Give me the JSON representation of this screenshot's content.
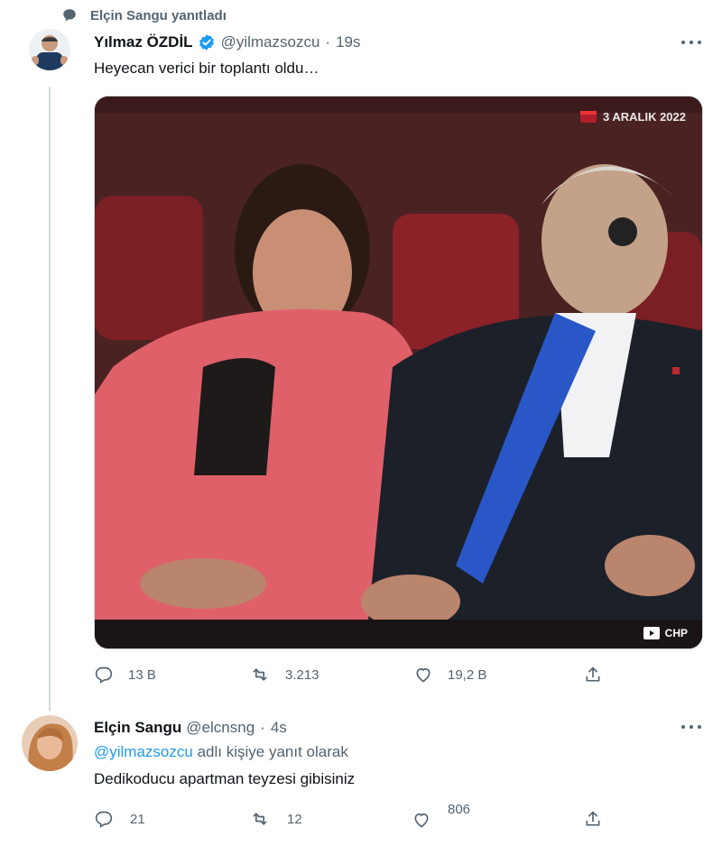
{
  "context": {
    "label": "Elçin Sangu yanıtladı",
    "icon": "speech-bubble-icon"
  },
  "tweet": {
    "author_name": "Yılmaz ÖZDİL",
    "verified": true,
    "handle": "@yilmazsozcu",
    "separator": "·",
    "time": "19s",
    "text": "Heyecan verici bir toplantı oldu…",
    "media": {
      "date_badge": "3 ARALIK 2022",
      "source_badge": "CHP"
    },
    "stats": {
      "replies": "13 B",
      "retweets": "3.213",
      "likes": "19,2 B"
    }
  },
  "reply": {
    "author_name": "Elçin Sangu",
    "handle": "@elcnsng",
    "separator": "·",
    "time": "4s",
    "reply_to_handle": "@yilmazsozcu",
    "reply_to_suffix": "adlı kişiye yanıt olarak",
    "text": "Dedikoducu apartman teyzesi gibisiniz",
    "stats": {
      "replies": "21",
      "retweets": "12",
      "likes": "806"
    }
  },
  "colors": {
    "accent": "#1d9bf0",
    "muted": "#536471",
    "text": "#0f1419"
  }
}
